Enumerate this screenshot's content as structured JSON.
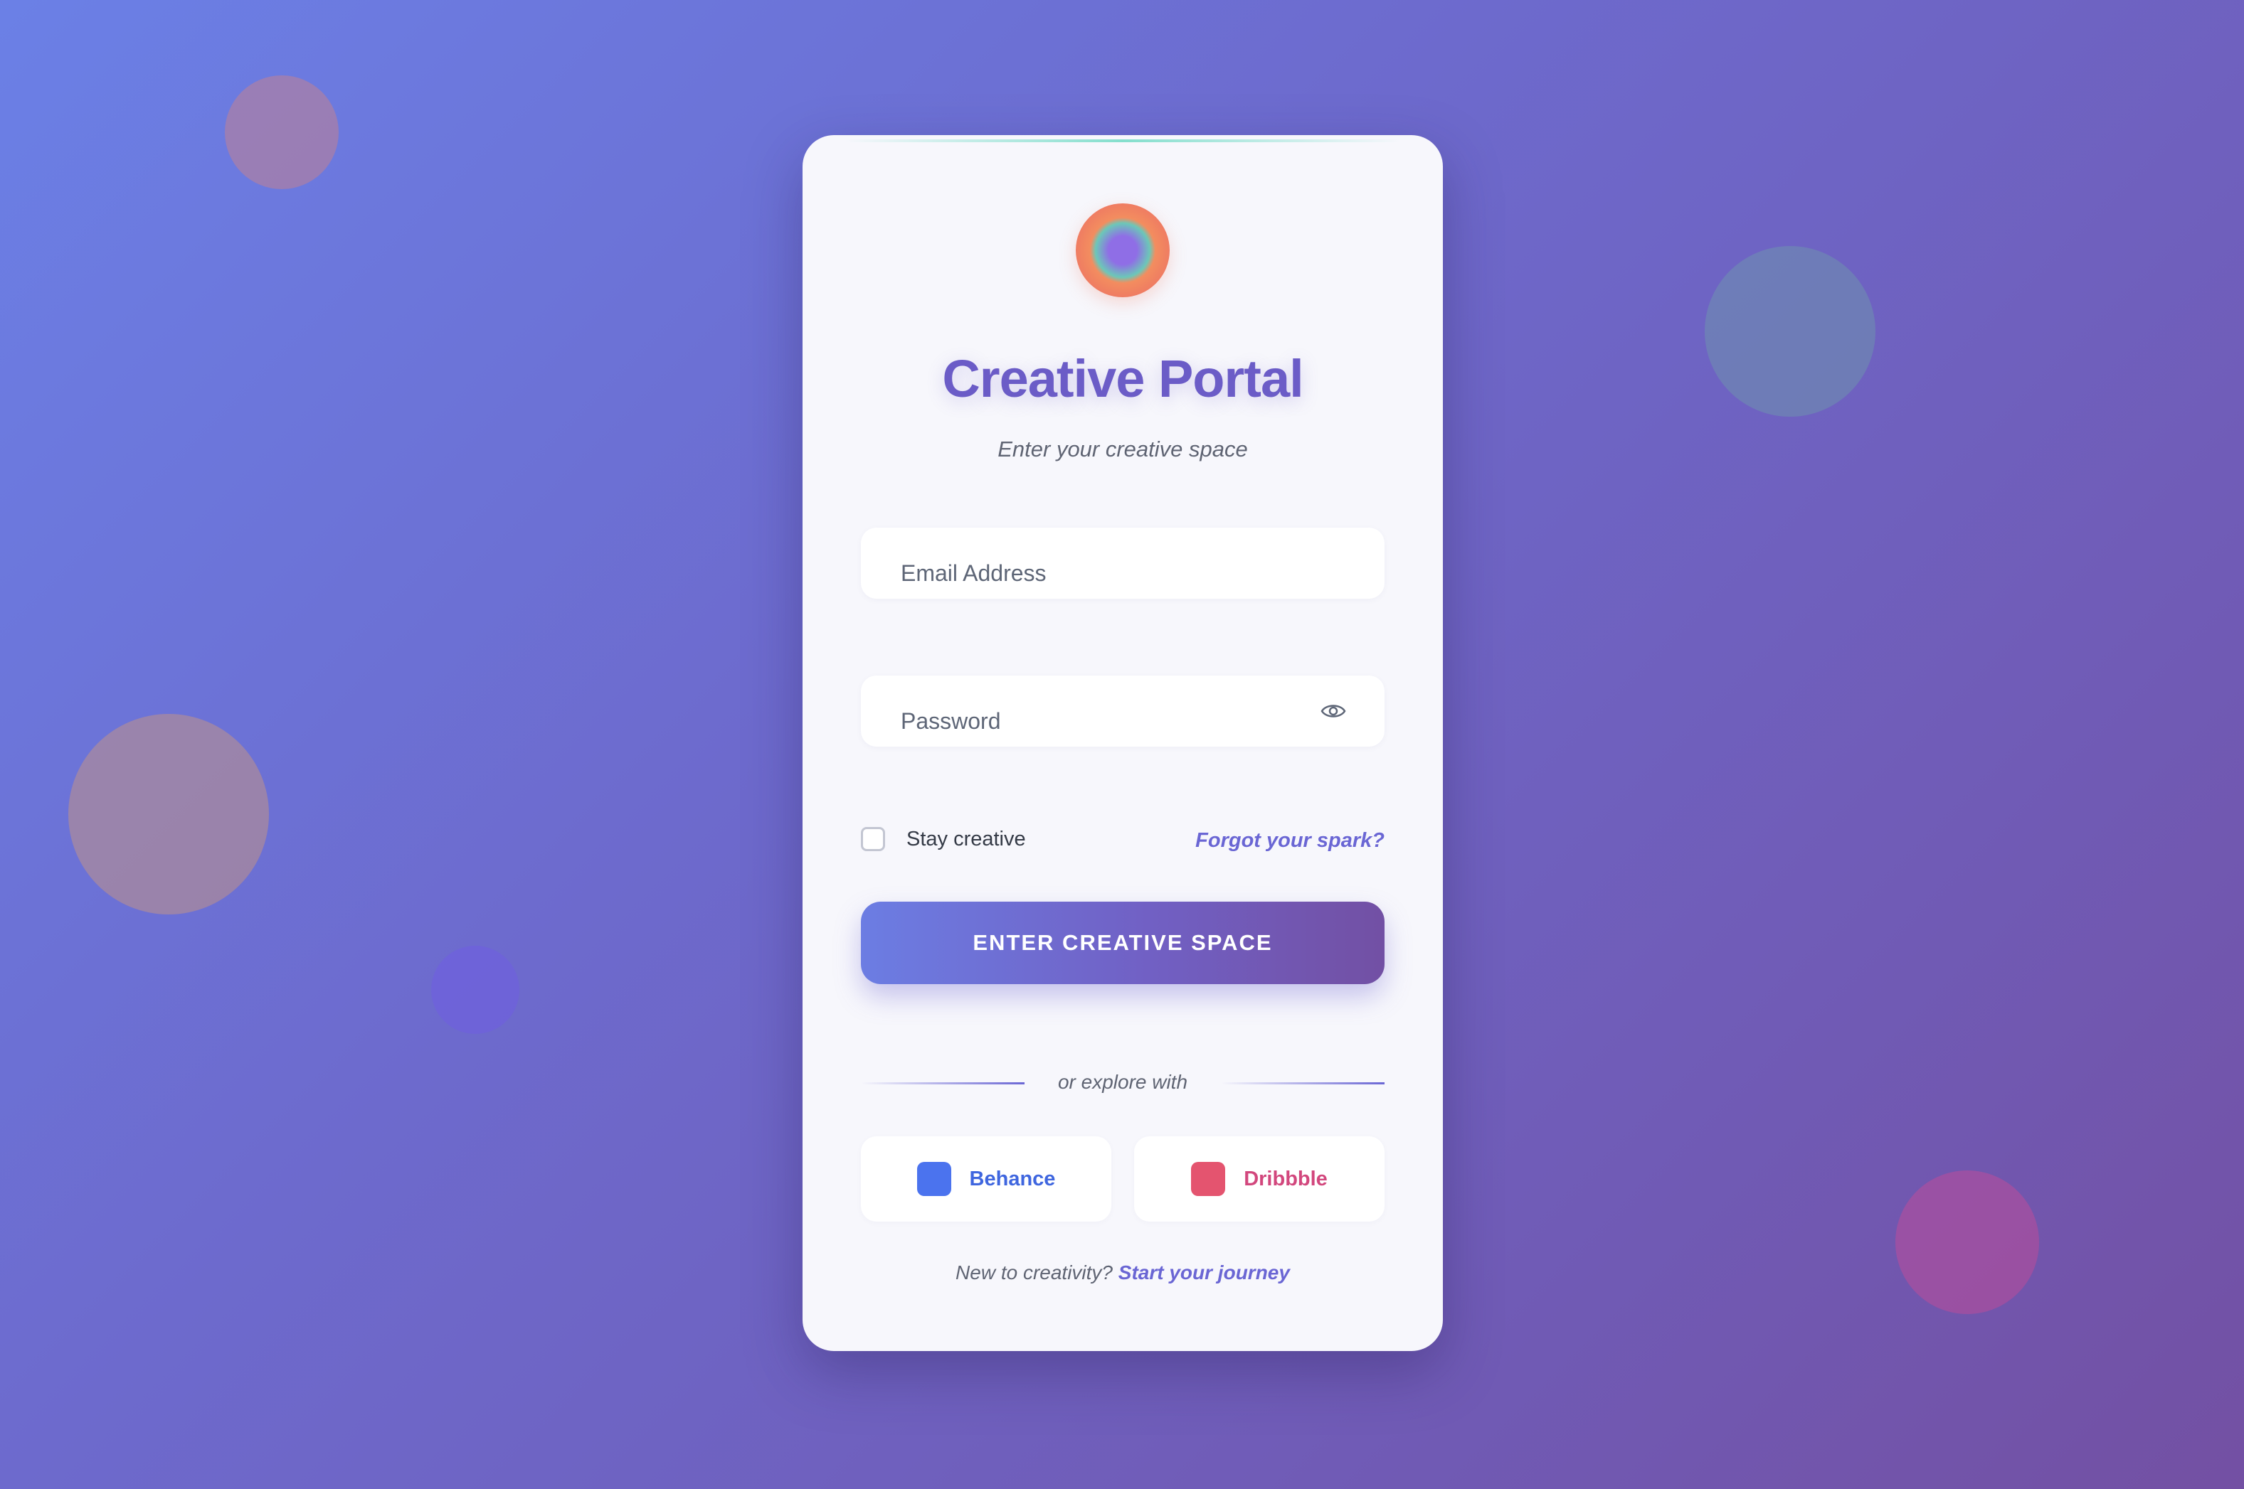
{
  "colors": {
    "accent": "#6a66d4",
    "title": "#6b5cc7",
    "behance": "#4b73ee",
    "dribbble": "#e4546f"
  },
  "brand": {
    "title": "Creative Portal",
    "subtitle": "Enter your creative space",
    "logo_icon": "concentric-circle-logo"
  },
  "form": {
    "email_placeholder": "Email Address",
    "password_placeholder": "Password",
    "password_toggle_icon": "eye-icon",
    "remember_label": "Stay creative",
    "forgot_link": "Forgot your spark?",
    "submit_label": "ENTER CREATIVE SPACE"
  },
  "social": {
    "divider_text": "or explore with",
    "buttons": [
      {
        "label": "Behance",
        "color": "#4b73ee",
        "icon": "behance-square-icon"
      },
      {
        "label": "Dribbble",
        "color": "#e4546f",
        "icon": "dribbble-square-icon"
      }
    ]
  },
  "footer": {
    "prompt": "New to creativity?",
    "link": "Start your journey"
  }
}
